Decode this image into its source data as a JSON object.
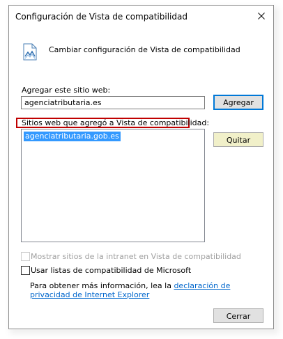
{
  "dialog": {
    "title": "Configuración de Vista de compatibilidad",
    "close_icon": "close-icon"
  },
  "header": {
    "icon": "compatibility-view-icon",
    "text": "Cambiar configuración de Vista de compatibilidad"
  },
  "add_site": {
    "label": "Agregar este sitio web:",
    "value": "agenciatributaria.es",
    "button_label": "Agregar"
  },
  "site_list": {
    "label": "Sitios web que agregó a Vista de compatibilidad:",
    "items": [
      {
        "text": "agenciatributaria.gob.es",
        "selected": true
      }
    ],
    "remove_label": "Quitar"
  },
  "options": {
    "intranet_label": "Mostrar sitios de la intranet en Vista de compatibilidad",
    "intranet_checked": false,
    "intranet_enabled": false,
    "microsoft_lists_label": "Usar listas de compatibilidad de Microsoft",
    "microsoft_lists_checked": false
  },
  "info": {
    "text": "Para obtener más información, lea la ",
    "link_text": "declaración de privacidad de Internet Explorer"
  },
  "footer": {
    "close_label": "Cerrar"
  },
  "colors": {
    "accent": "#0078d7",
    "selection": "#3399ff",
    "highlight_border": "#c00000",
    "link": "#0066cc",
    "quitar_bg": "#f1f0c9"
  }
}
